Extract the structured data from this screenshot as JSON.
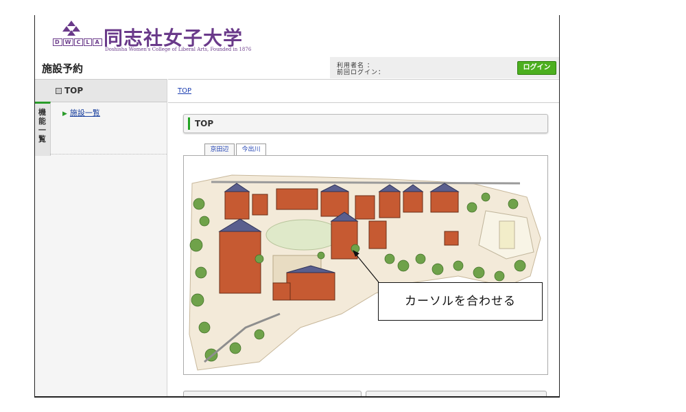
{
  "header": {
    "logo_letters": [
      "D",
      "W",
      "C",
      "L",
      "A"
    ],
    "logo_name": "同志社女子大学",
    "logo_subtitle": "Doshisha Women's College of Liberal Arts, Founded in 1876",
    "app_title": "施設予約"
  },
  "userbar": {
    "user_label": "利用者名 ：",
    "last_login_label": "前回ログイン：",
    "login_button": "ログイン"
  },
  "sidebar": {
    "top_label": "TOP",
    "tab_label": "機能一覧",
    "items": [
      {
        "label": "施設一覧"
      }
    ]
  },
  "breadcrumb": "TOP",
  "main": {
    "section_title": "TOP",
    "campus_tabs": [
      {
        "label": "京田辺",
        "selected": true
      },
      {
        "label": "今出川",
        "selected": false
      }
    ]
  },
  "callout": {
    "text": "カーソルを合わせる"
  },
  "colors": {
    "brand_purple": "#6a3a8a",
    "accent_green": "#22a322",
    "login_green": "#4caf1f",
    "link_blue": "#1a3cb0"
  }
}
